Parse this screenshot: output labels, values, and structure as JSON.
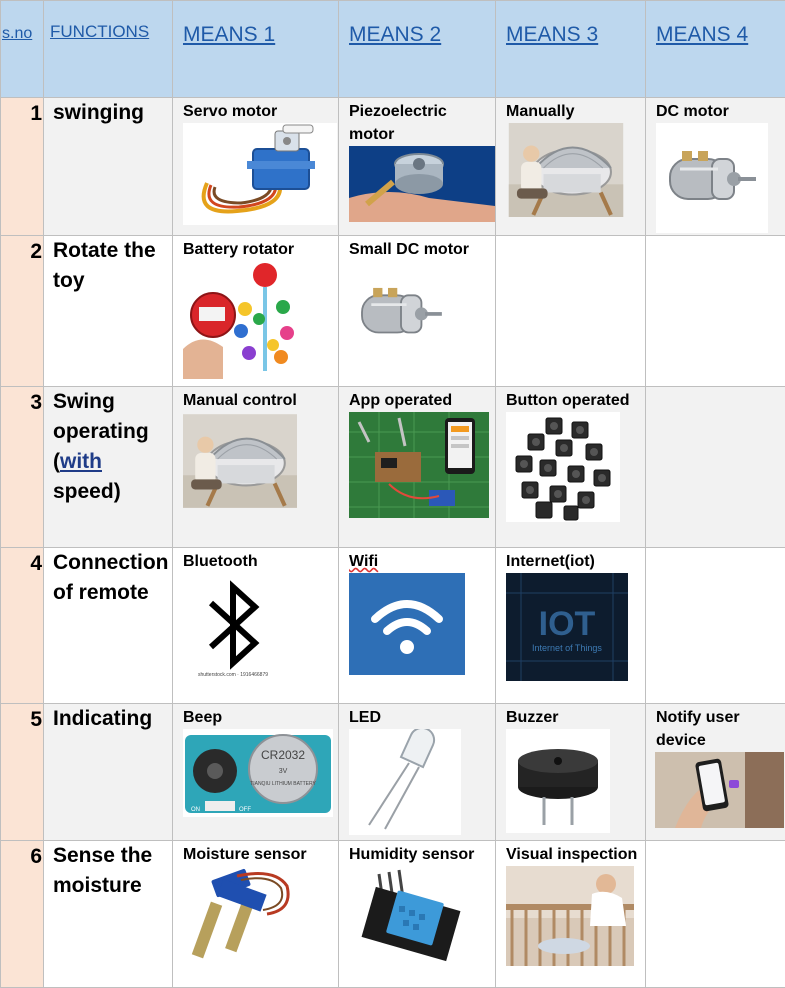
{
  "header": {
    "sno": "s.no",
    "functions": "FUNCTIONS",
    "means": [
      "MEANS 1",
      "MEANS 2",
      "MEANS 3",
      "MEANS 4"
    ]
  },
  "rows": [
    {
      "num": "1",
      "function": "swinging",
      "means": [
        "Servo motor",
        "Piezoelectric motor",
        "Manually",
        "DC motor"
      ]
    },
    {
      "num": "2",
      "function": "Rotate the toy",
      "means": [
        "Battery rotator",
        "Small DC motor",
        "",
        ""
      ]
    },
    {
      "num": "3",
      "function_parts": [
        "Swing operating (",
        "with",
        " speed)"
      ],
      "means": [
        "Manual control",
        "App operated",
        "Button operated",
        ""
      ]
    },
    {
      "num": "4",
      "function": "Connection of remote",
      "means": [
        "Bluetooth",
        "Wifi",
        "Internet(iot)",
        ""
      ]
    },
    {
      "num": "5",
      "function": "Indicating",
      "means": [
        "Beep",
        "LED",
        "Buzzer",
        "Notify user device"
      ]
    },
    {
      "num": "6",
      "function": "Sense the moisture",
      "means": [
        "Moisture sensor",
        "Humidity sensor",
        "Visual inspection",
        ""
      ]
    }
  ],
  "image_text": {
    "iot_big": "IOT",
    "iot_small": "Internet of Things",
    "battery_line1": "CR2032",
    "battery_line2": "TIANQIU LITHIUM BATTERY",
    "battery_volt": "3V",
    "bt_caption": "shutterstock.com · 1916466879",
    "switch_on": "ON",
    "switch_off": "OFF"
  },
  "icons": {
    "servo": "servo-motor-icon",
    "piezo": "piezo-motor-icon",
    "cradle": "cradle-icon",
    "dc": "dc-motor-icon",
    "toy": "rotating-toy-icon",
    "app": "circuit-board-icon",
    "buttons": "push-buttons-icon",
    "bluetooth": "bluetooth-icon",
    "wifi": "wifi-icon",
    "iot": "iot-icon",
    "beep": "beep-module-icon",
    "led": "led-icon",
    "buzzer": "buzzer-icon",
    "phone": "smartphone-icon",
    "moisture": "moisture-sensor-icon",
    "humidity": "humidity-sensor-icon",
    "crib": "crib-icon"
  },
  "colors": {
    "header_bg": "#bdd7ee",
    "header_text": "#1f5aa8",
    "sno_bg": "#fbe4d5",
    "stripe_bg": "#f2f2f2",
    "wifi_bg": "#2e6fb6",
    "iot_bg": "#0d1c2e"
  }
}
